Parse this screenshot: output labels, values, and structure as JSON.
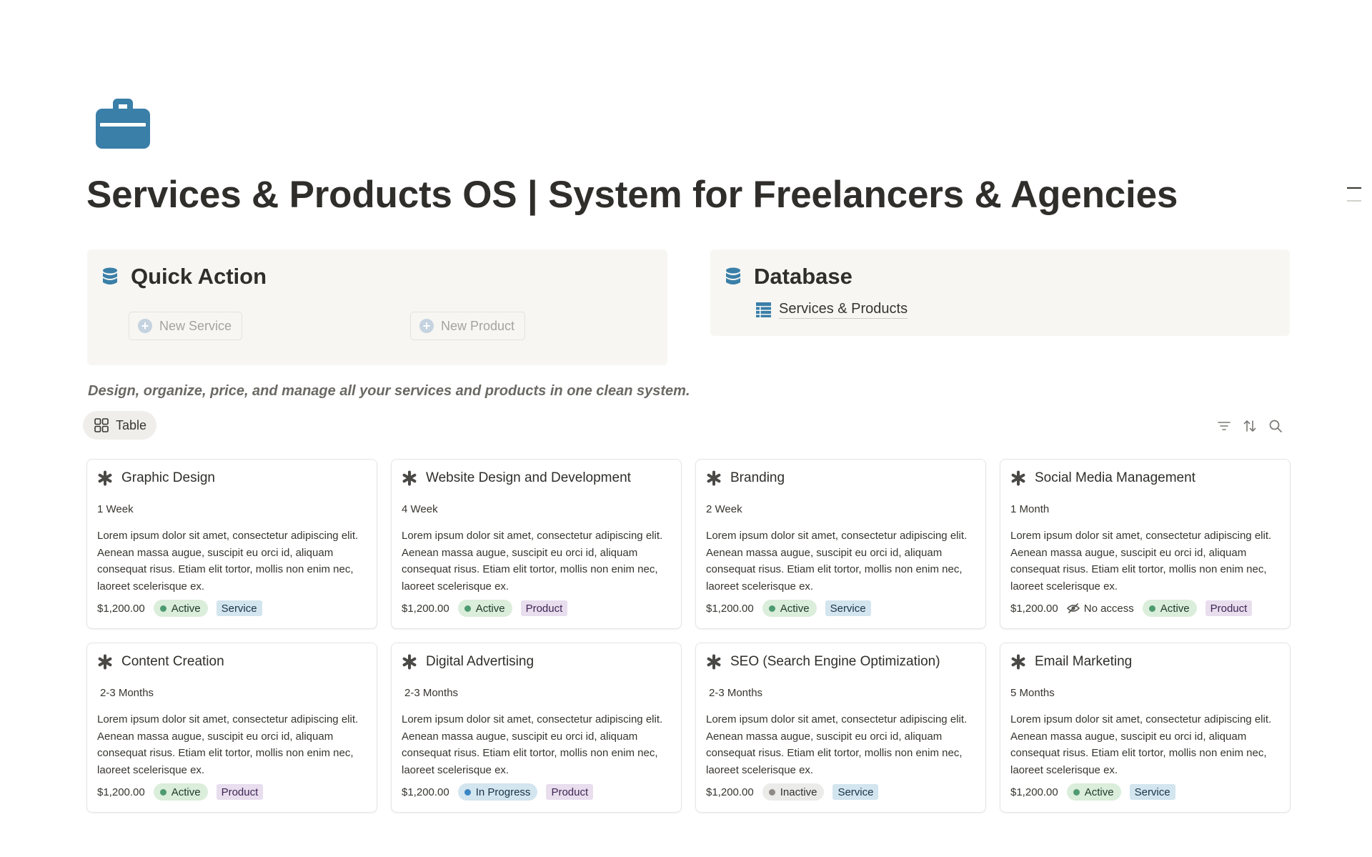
{
  "page": {
    "icon": "briefcase-icon",
    "title": "Services & Products OS | System for Freelancers & Agencies",
    "description": "Design, organize, price, and manage all your services and products in one clean system.",
    "accent_color": "#3a7fa8"
  },
  "quick_action": {
    "title": "Quick Action",
    "icon": "database-icon",
    "new_service_label": "New Service",
    "new_product_label": "New Product"
  },
  "database": {
    "title": "Database",
    "icon": "database-icon",
    "link_label": "Services & Products",
    "link_icon": "table-icon"
  },
  "view": {
    "tab_label": "Table",
    "tab_icon": "gallery-grid-icon",
    "toolbar_icons": [
      "filter-icon",
      "sort-icon",
      "search-icon"
    ]
  },
  "cards": [
    {
      "title": "Graphic Design",
      "duration": "1 Week",
      "description": "Lorem ipsum dolor sit amet, consectetur adipiscing elit. Aenean massa augue, suscipit eu orci id, aliquam consequat risus. Etiam elit tortor, mollis non enim nec, laoreet scelerisque ex.",
      "price": "$1,200.00",
      "status": "Active",
      "type": "Service"
    },
    {
      "title": "Website Design and Development",
      "duration": "4 Week",
      "description": "Lorem ipsum dolor sit amet, consectetur adipiscing elit. Aenean massa augue, suscipit eu orci id, aliquam consequat risus. Etiam elit tortor, mollis non enim nec, laoreet scelerisque ex.",
      "price": "$1,200.00",
      "status": "Active",
      "type": "Product"
    },
    {
      "title": "Branding",
      "duration": "2 Week",
      "description": "Lorem ipsum dolor sit amet, consectetur adipiscing elit. Aenean massa augue, suscipit eu orci id, aliquam consequat risus. Etiam elit tortor, mollis non enim nec, laoreet scelerisque ex.",
      "price": "$1,200.00",
      "status": "Active",
      "type": "Service"
    },
    {
      "title": "Social Media Management",
      "duration": "1 Month",
      "description": "Lorem ipsum dolor sit amet, consectetur adipiscing elit. Aenean massa augue, suscipit eu orci id, aliquam consequat risus. Etiam elit tortor, mollis non enim nec, laoreet scelerisque ex.",
      "price": "$1,200.00",
      "access": "No access",
      "status": "Active",
      "type": "Product"
    },
    {
      "title": "Content Creation",
      "duration": "2-3 Months",
      "description": "Lorem ipsum dolor sit amet, consectetur adipiscing elit. Aenean massa augue, suscipit eu orci id, aliquam consequat risus. Etiam elit tortor, mollis non enim nec, laoreet scelerisque ex.",
      "price": "$1,200.00",
      "status": "Active",
      "type": "Product"
    },
    {
      "title": "Digital Advertising",
      "duration": "2-3 Months",
      "description": "Lorem ipsum dolor sit amet, consectetur adipiscing elit. Aenean massa augue, suscipit eu orci id, aliquam consequat risus. Etiam elit tortor, mollis non enim nec, laoreet scelerisque ex.",
      "price": "$1,200.00",
      "status": "In Progress",
      "type": "Product"
    },
    {
      "title": "SEO (Search Engine Optimization)",
      "duration": "2-3 Months",
      "description": "Lorem ipsum dolor sit amet, consectetur adipiscing elit. Aenean massa augue, suscipit eu orci id, aliquam consequat risus. Etiam elit tortor, mollis non enim nec, laoreet scelerisque ex.",
      "price": "$1,200.00",
      "status": "Inactive",
      "type": "Service"
    },
    {
      "title": "Email Marketing",
      "duration": "5 Months",
      "description": "Lorem ipsum dolor sit amet, consectetur adipiscing elit. Aenean massa augue, suscipit eu orci id, aliquam consequat risus. Etiam elit tortor, mollis non enim nec, laoreet scelerisque ex.",
      "price": "$1,200.00",
      "status": "Active",
      "type": "Service"
    }
  ],
  "colors": {
    "status_active": "#4d9b6f",
    "status_in_progress": "#3a86c4",
    "status_inactive": "#8e8b86",
    "tag_service_bg": "#d3e5ef",
    "tag_product_bg": "#e8deee"
  }
}
